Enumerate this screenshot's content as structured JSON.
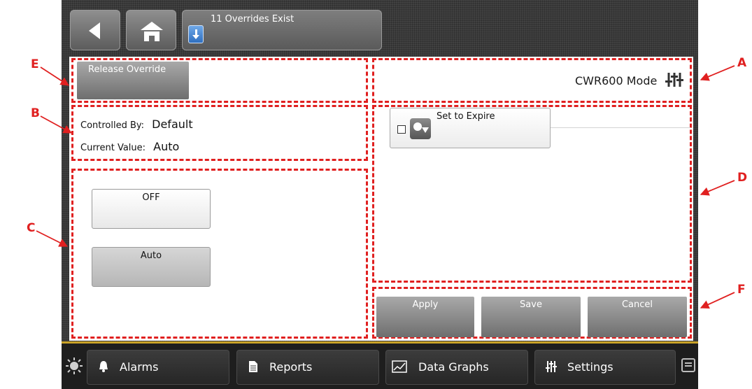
{
  "toolbar": {
    "back_icon": "back-arrow-icon",
    "home_icon": "home-icon",
    "override_notice": "11 Overrides Exist",
    "override_icon": "download-arrow-icon"
  },
  "release_override": {
    "label": "Release Override"
  },
  "mode": {
    "title": "CWR600 Mode",
    "icon": "sliders-icon"
  },
  "info": {
    "controlled_by_label": "Controlled By:",
    "controlled_by_value": "Default",
    "current_value_label": "Current Value:",
    "current_value_value": "Auto"
  },
  "options": [
    {
      "label": "OFF",
      "selected": false
    },
    {
      "label": "Auto",
      "selected": true
    }
  ],
  "expire": {
    "label": "Set to Expire",
    "checked": false,
    "icon": "clock-download-icon"
  },
  "actions": {
    "apply": "Apply",
    "save": "Save",
    "cancel": "Cancel"
  },
  "nav": {
    "alarms": "Alarms",
    "reports": "Reports",
    "data_graphs": "Data Graphs",
    "settings": "Settings"
  },
  "annotations": {
    "a": "A",
    "b": "B",
    "c": "C",
    "d": "D",
    "e": "E",
    "f": "F",
    "color": "#e02020"
  },
  "colors": {
    "accent_bar": "#c9a227",
    "highlight_blue": "#2f6fc0"
  }
}
